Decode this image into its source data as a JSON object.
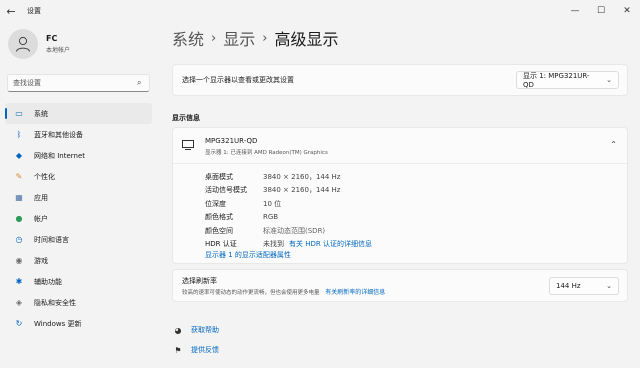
{
  "window": {
    "title": "设置"
  },
  "profile": {
    "name": "FC",
    "type": "本地帐户"
  },
  "search": {
    "placeholder": "查找设置"
  },
  "sidebar": {
    "items": [
      {
        "label": "系统",
        "icon": "monitor-icon",
        "color": "#0067c0",
        "active": true
      },
      {
        "label": "蓝牙和其他设备",
        "icon": "bluetooth-icon",
        "color": "#0067c0"
      },
      {
        "label": "网络和 Internet",
        "icon": "wifi-icon",
        "color": "#0067c0"
      },
      {
        "label": "个性化",
        "icon": "brush-icon",
        "color": "#d08a2a"
      },
      {
        "label": "应用",
        "icon": "apps-icon",
        "color": "#4a6fa5"
      },
      {
        "label": "帐户",
        "icon": "person-icon",
        "color": "#2e9a5b"
      },
      {
        "label": "时间和语言",
        "icon": "globe-clock-icon",
        "color": "#0067c0"
      },
      {
        "label": "游戏",
        "icon": "gamepad-icon",
        "color": "#6b6b6b"
      },
      {
        "label": "辅助功能",
        "icon": "accessibility-icon",
        "color": "#0067c0"
      },
      {
        "label": "隐私和安全性",
        "icon": "shield-icon",
        "color": "#6b6b6b"
      },
      {
        "label": "Windows 更新",
        "icon": "update-icon",
        "color": "#0067c0"
      }
    ]
  },
  "breadcrumb": {
    "part1": "系统",
    "part2": "显示",
    "current": "高级显示"
  },
  "select_display": {
    "label": "选择一个显示器以查看或更改其设置",
    "value": "显示 1: MPG321UR-QD"
  },
  "info_section_title": "显示信息",
  "monitor": {
    "name": "MPG321UR-QD",
    "subtitle": "显示器 1: 已连接到 AMD Radeon(TM) Graphics",
    "rows": [
      {
        "key": "桌面模式",
        "value": "3840 × 2160，144 Hz"
      },
      {
        "key": "活动信号模式",
        "value": "3840 × 2160，144 Hz"
      },
      {
        "key": "位深度",
        "value": "10 位"
      },
      {
        "key": "颜色格式",
        "value": "RGB"
      },
      {
        "key": "颜色空间",
        "value": "标准动态范围(SDR)"
      },
      {
        "key": "HDR 认证",
        "value": "未找到",
        "link": "有关 HDR 认证的详细信息"
      }
    ],
    "adapter_link": "显示器 1 的显示适配器属性"
  },
  "refresh": {
    "label": "选择刷新率",
    "desc": "较高的速率可使动态的动作更流畅，但也会使用更多电量",
    "link": "有关刷新率的详细信息",
    "value": "144 Hz"
  },
  "help": {
    "get_help": "获取帮助",
    "feedback": "提供反馈"
  }
}
